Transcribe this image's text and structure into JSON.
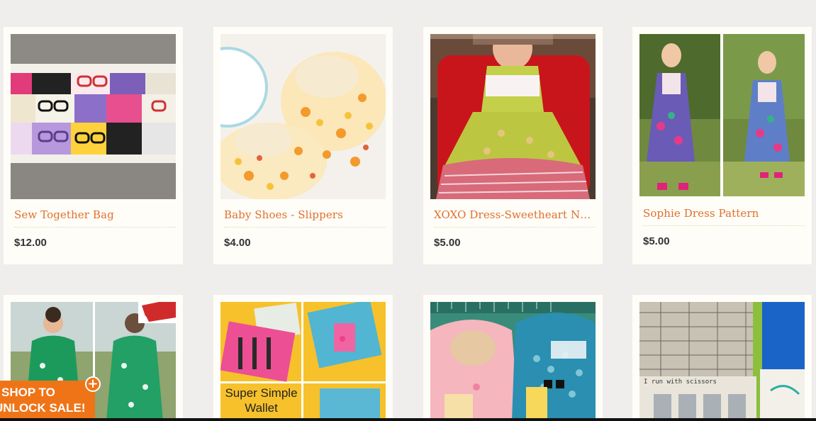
{
  "products": [
    {
      "title": "Sew Together Bag",
      "price": "$12.00",
      "image": "glasses-fabric-bag"
    },
    {
      "title": "Baby Shoes - Slippers",
      "price": "$4.00",
      "image": "flower-baby-slippers"
    },
    {
      "title": "XOXO Dress-Sweetheart Ne…",
      "price": "$5.00",
      "image": "green-floral-dress"
    },
    {
      "title": "Sophie Dress Pattern",
      "price": "$5.00",
      "image": "girl-in-patterned-dress"
    },
    {
      "title": "",
      "price": "",
      "image": "green-print-tunic"
    },
    {
      "title": "",
      "price": "",
      "image": "patchwork-wallet",
      "overlay_line1": "Super Simple",
      "overlay_line2": "Wallet"
    },
    {
      "title": "",
      "price": "",
      "image": "patchwork-bibs"
    },
    {
      "title": "",
      "price": "",
      "image": "needle-case-scissors",
      "overlay_text": "I run with scissors"
    }
  ],
  "promo": {
    "line1": "SHOP TO",
    "line2": "UNLOCK SALE!",
    "icon": "plus-circle-icon"
  },
  "colors": {
    "title": "#e0702c",
    "promo": "#ef7417",
    "price": "#333333"
  }
}
